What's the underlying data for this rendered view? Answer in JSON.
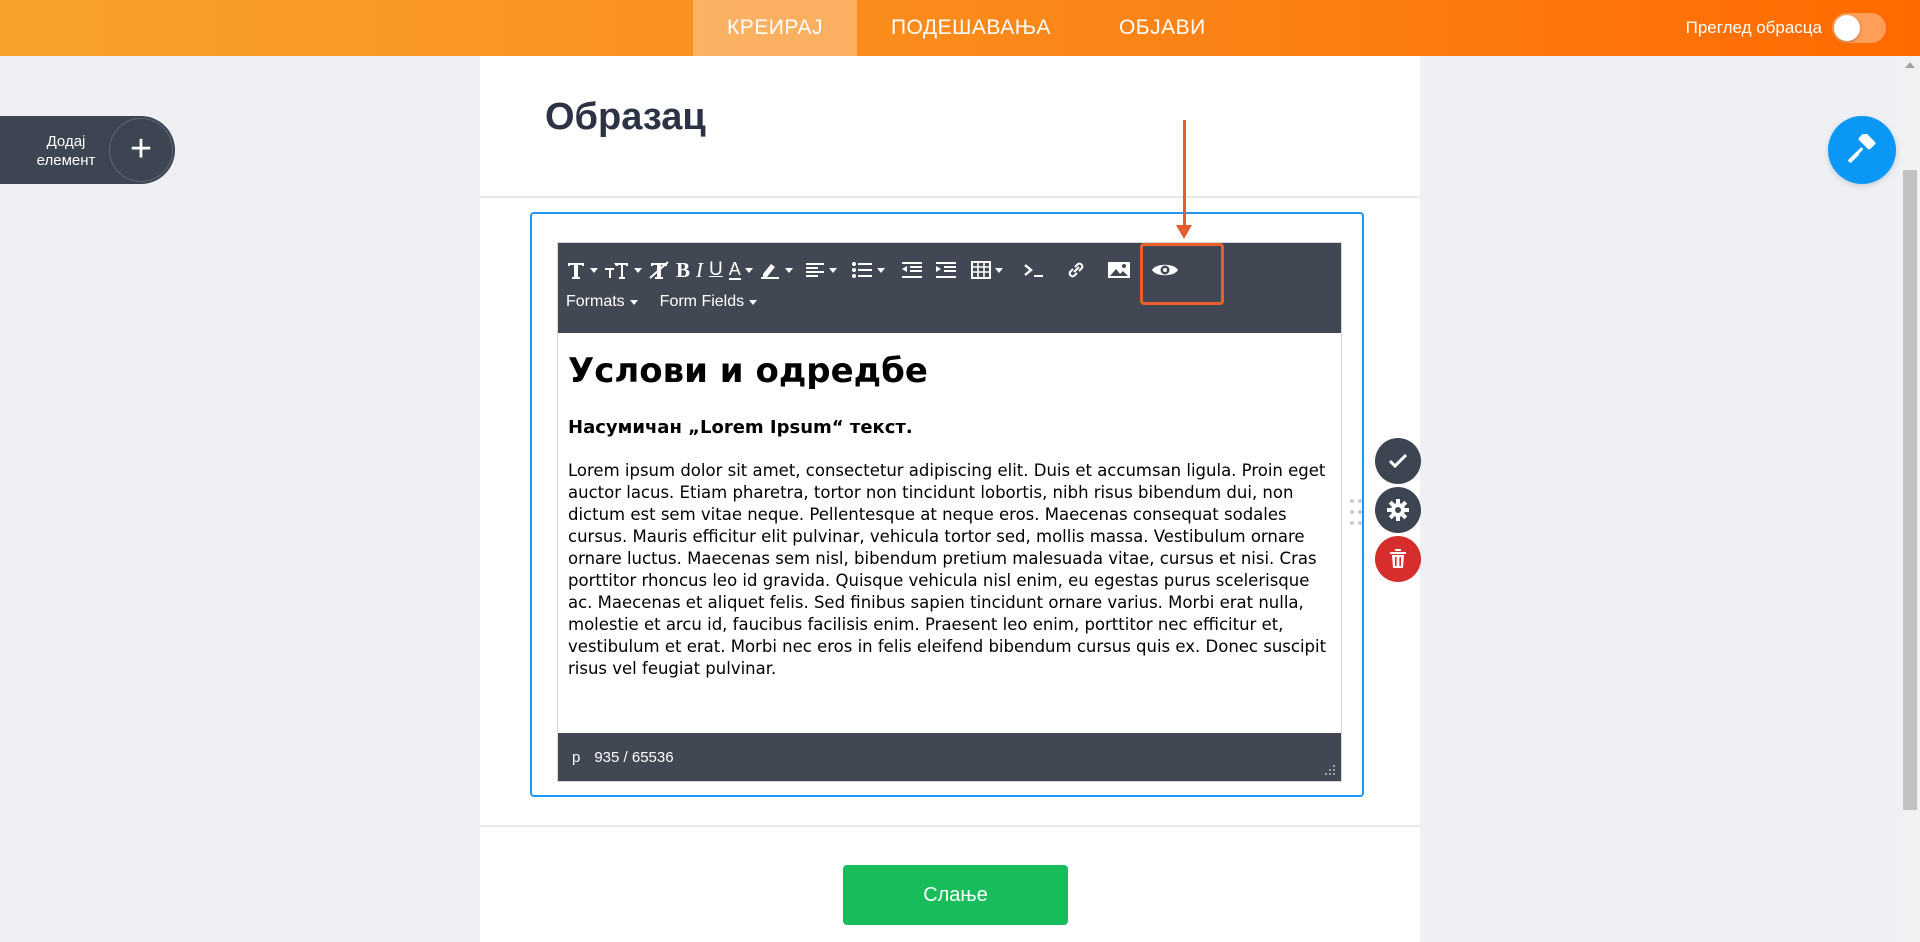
{
  "topbar": {
    "tabs": [
      {
        "label": "КРЕИРАЈ"
      },
      {
        "label": "ПОДЕШАВАЊА"
      },
      {
        "label": "ОБЈАВИ"
      }
    ],
    "preview_label": "Преглед обрасца"
  },
  "add_element": {
    "label": "Додај елемент"
  },
  "form": {
    "title": "Образац",
    "submit_label": "Слање"
  },
  "editor": {
    "toolbar_row2": [
      {
        "label": "Formats"
      },
      {
        "label": "Form Fields"
      }
    ],
    "heading": "Услови и одредбе",
    "subheading": "Насумичан „Lorem Ipsum“ текст.",
    "paragraph": "Lorem ipsum dolor sit amet, consectetur adipiscing elit. Duis et accumsan ligula. Proin eget auctor lacus. Etiam pharetra, tortor non tincidunt lobortis, nibh risus bibendum dui, non dictum est sem vitae neque. Pellentesque at neque eros. Maecenas consequat sodales cursus. Mauris efficitur elit pulvinar, vehicula tortor sed, mollis massa. Vestibulum ornare ornare luctus. Maecenas sem nisl, bibendum pretium malesuada vitae, cursus et nisi. Cras porttitor rhoncus leo id gravida. Quisque vehicula nisl enim, eu egestas purus scelerisque ac. Maecenas et aliquet felis. Sed finibus sapien tincidunt ornare varius. Morbi erat nulla, molestie et arcu id, faucibus facilisis enim. Praesent leo enim, porttitor nec efficitur et, vestibulum et erat. Morbi nec eros in felis eleifend bibendum cursus quis ex. Donec suscipit risus vel feugiat pulvinar.",
    "status_tag": "p",
    "char_count": "935 / 65536"
  },
  "colors": {
    "accent_orange": "#ff6a00",
    "field_border": "#2196f3",
    "annotation": "#ec5f2d",
    "submit": "#18bd5b",
    "delete": "#d62d2d"
  }
}
